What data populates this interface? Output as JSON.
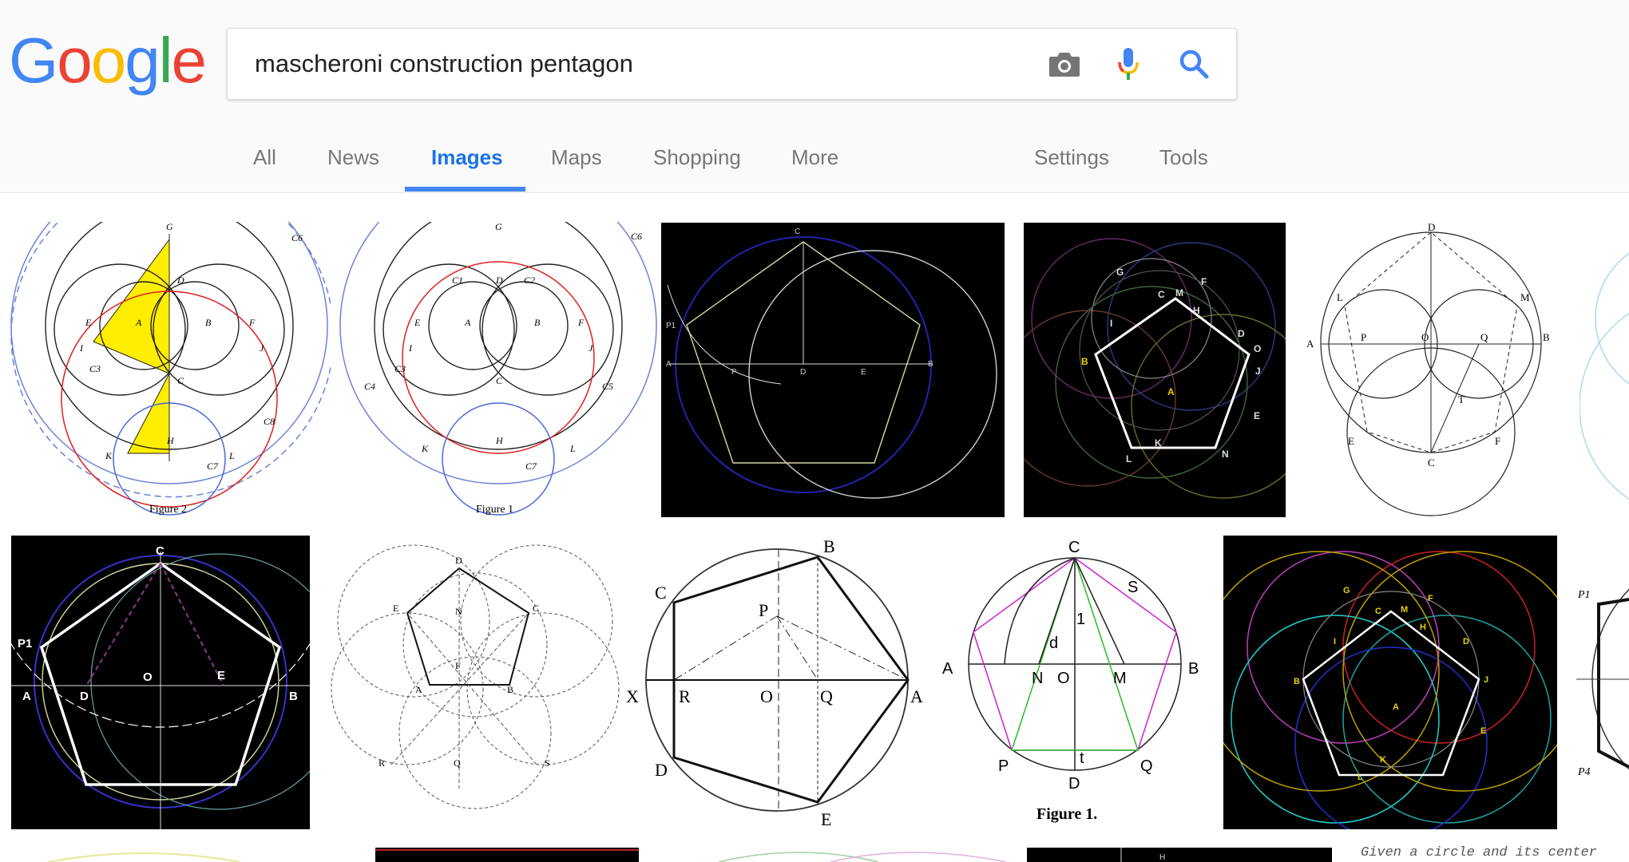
{
  "logo": {
    "letters": [
      "G",
      "o",
      "o",
      "g",
      "l",
      "e"
    ],
    "colors": [
      "#4285F4",
      "#EA4335",
      "#FBBC05",
      "#4285F4",
      "#34A853",
      "#EA4335"
    ]
  },
  "search": {
    "query": "mascheroni construction pentagon",
    "icons": [
      "camera-icon",
      "microphone-icon",
      "search-icon"
    ]
  },
  "tabs": [
    {
      "label": "All"
    },
    {
      "label": "News"
    },
    {
      "label": "Images",
      "active": true
    },
    {
      "label": "Maps"
    },
    {
      "label": "Shopping"
    },
    {
      "label": "More"
    },
    {
      "label": "Settings"
    },
    {
      "label": "Tools"
    }
  ],
  "results": {
    "r1": {
      "t1": {
        "caption": "Figure 2",
        "labels": [
          "G",
          "D",
          "E",
          "A",
          "B",
          "F",
          "I",
          "J",
          "C",
          "K",
          "H",
          "L",
          "C3",
          "C6",
          "C7",
          "C8"
        ]
      },
      "t2": {
        "caption": "Figure 1",
        "labels": [
          "G",
          "C1",
          "D",
          "C2",
          "E",
          "A",
          "B",
          "F",
          "I",
          "J",
          "C",
          "K",
          "H",
          "L",
          "C3",
          "C4",
          "C5",
          "C6",
          "C7"
        ]
      },
      "t3": {
        "labels": [
          "C",
          "P1",
          "A",
          "P",
          "D",
          "E",
          "B"
        ]
      },
      "t4": {
        "labels": [
          "G",
          "F",
          "M",
          "C",
          "H",
          "I",
          "D",
          "O",
          "B",
          "J",
          "A",
          "E",
          "K",
          "L",
          "N"
        ]
      },
      "t5": {
        "labels": [
          "D",
          "L",
          "M",
          "A",
          "P",
          "O",
          "Q",
          "B",
          "T",
          "E",
          "F",
          "C"
        ]
      }
    },
    "r2": {
      "t1": {
        "labels": [
          "C",
          "P1",
          "O",
          "E",
          "A",
          "D",
          "B"
        ]
      },
      "t2": {
        "labels": [
          "D",
          "E",
          "C",
          "N",
          "F",
          "A",
          "B",
          "R",
          "Q",
          "S"
        ]
      },
      "t3": {
        "labels": [
          "B",
          "C",
          "P",
          "X",
          "R",
          "O",
          "Q",
          "A",
          "D",
          "E"
        ]
      },
      "t4": {
        "caption": "Figure 1.",
        "labels": [
          "C",
          "S",
          "1",
          "d",
          "A",
          "N",
          "O",
          "M",
          "B",
          "P",
          "t",
          "Q",
          "D"
        ]
      },
      "t5": {
        "labels": [
          "G",
          "F",
          "M",
          "C",
          "H",
          "I",
          "D",
          "B",
          "J",
          "A",
          "E",
          "L",
          "K"
        ]
      },
      "t6": {
        "labels": [
          "P1",
          "P4"
        ]
      }
    },
    "r3": {
      "snippet": "Given a circle and its center"
    }
  }
}
